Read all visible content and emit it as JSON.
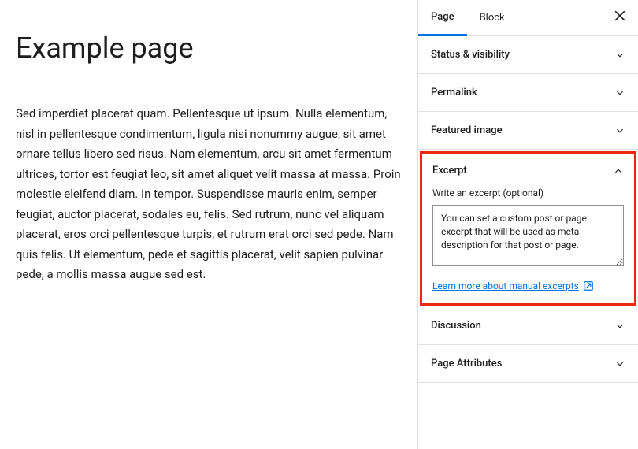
{
  "main": {
    "title": "Example page",
    "content": "Sed imperdiet placerat quam. Pellentesque ut ipsum. Nulla elementum, nisl in pellentesque condimentum, ligula nisi nonummy augue, sit amet ornare tellus libero sed risus. Nam elementum, arcu sit amet fermentum ultrices, tortor est feugiat leo, sit amet aliquet velit massa at massa. Proin molestie eleifend diam. In tempor. Suspendisse mauris enim, semper feugiat, auctor placerat, sodales eu, felis. Sed rutrum, nunc vel aliquam placerat, eros orci pellentesque turpis, et rutrum erat orci sed pede. Nam quis felis. Ut elementum, pede et sagittis placerat, velit sapien pulvinar pede, a mollis massa augue sed est."
  },
  "sidebar": {
    "tabs": {
      "page": "Page",
      "block": "Block"
    },
    "panels": {
      "status": {
        "title": "Status & visibility"
      },
      "permalink": {
        "title": "Permalink"
      },
      "featured_image": {
        "title": "Featured image"
      },
      "excerpt": {
        "title": "Excerpt",
        "field_label": "Write an excerpt (optional)",
        "value": "You can set a custom post or page excerpt that will be used as meta description for that post or page.",
        "learn_link": "Learn more about manual excerpts"
      },
      "discussion": {
        "title": "Discussion"
      },
      "page_attributes": {
        "title": "Page Attributes"
      }
    }
  }
}
